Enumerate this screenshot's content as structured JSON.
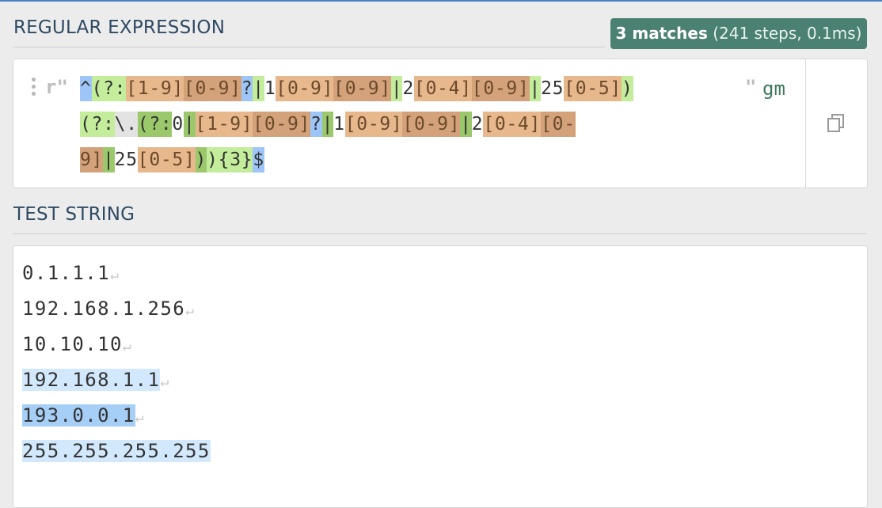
{
  "regex_section": {
    "title": "REGULAR EXPRESSION",
    "badge": {
      "count": "3 matches",
      "details": "(241 steps, 0.1ms)"
    },
    "delimiter_open": "r\"",
    "delimiter_close": "\"",
    "flags": "gm",
    "pattern_lines": [
      [
        {
          "t": "^",
          "c": "b"
        },
        {
          "t": "(?:",
          "c": "g"
        },
        {
          "t": "[1-9]",
          "c": "o"
        },
        {
          "t": "[0-9]",
          "c": "od"
        },
        {
          "t": "?",
          "c": "b"
        },
        {
          "t": "|",
          "c": "g"
        },
        {
          "t": "1",
          "c": ""
        },
        {
          "t": "[0-9]",
          "c": "o"
        },
        {
          "t": "[0-9]",
          "c": "od"
        },
        {
          "t": "|",
          "c": "g"
        },
        {
          "t": "2",
          "c": ""
        },
        {
          "t": "[0-4]",
          "c": "o"
        },
        {
          "t": "[0-9]",
          "c": "od"
        },
        {
          "t": "|",
          "c": "g"
        },
        {
          "t": "25",
          "c": ""
        },
        {
          "t": "[0-5]",
          "c": "o"
        },
        {
          "t": ")",
          "c": "g"
        }
      ],
      [
        {
          "t": "(?:",
          "c": "g"
        },
        {
          "t": "\\.",
          "c": "gy"
        },
        {
          "t": "(?:",
          "c": "gd"
        },
        {
          "t": "0",
          "c": ""
        },
        {
          "t": "|",
          "c": "gd"
        },
        {
          "t": "[1-9]",
          "c": "o"
        },
        {
          "t": "[0-9]",
          "c": "od"
        },
        {
          "t": "?",
          "c": "b"
        },
        {
          "t": "|",
          "c": "gd"
        },
        {
          "t": "1",
          "c": ""
        },
        {
          "t": "[0-9]",
          "c": "o"
        },
        {
          "t": "[0-9]",
          "c": "od"
        },
        {
          "t": "|",
          "c": "gd"
        },
        {
          "t": "2",
          "c": ""
        },
        {
          "t": "[0-4]",
          "c": "o"
        },
        {
          "t": "[0-",
          "c": "od"
        }
      ],
      [
        {
          "t": "9]",
          "c": "od"
        },
        {
          "t": "|",
          "c": "gd"
        },
        {
          "t": "25",
          "c": ""
        },
        {
          "t": "[0-5]",
          "c": "o"
        },
        {
          "t": ")",
          "c": "gd"
        },
        {
          "t": ")",
          "c": "g"
        },
        {
          "t": "{3}",
          "c": "g"
        },
        {
          "t": "$",
          "c": "b"
        }
      ]
    ]
  },
  "test_section": {
    "title": "TEST STRING",
    "lines": [
      {
        "text": "0.1.1.1",
        "newline": true,
        "match": ""
      },
      {
        "text": "192.168.1.256",
        "newline": true,
        "match": ""
      },
      {
        "text": "10.10.10",
        "newline": true,
        "match": ""
      },
      {
        "text": "192.168.1.1",
        "newline": true,
        "match": "m1"
      },
      {
        "text": "193.0.0.1",
        "newline": true,
        "match": "m2"
      },
      {
        "text": "255.255.255.255",
        "newline": false,
        "match": "m1"
      }
    ],
    "newline_symbol": "↵"
  },
  "icons": [
    "drag-handle-icon",
    "copy-icon"
  ]
}
